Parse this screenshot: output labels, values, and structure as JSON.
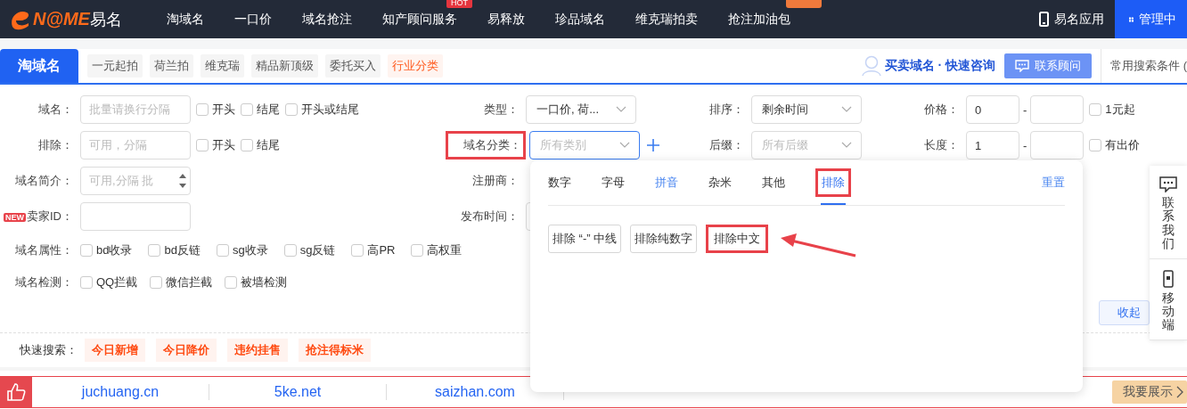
{
  "nav": {
    "logo": {
      "mark": "N@ME",
      "cn": "易名"
    },
    "items": [
      {
        "label": "淘域名"
      },
      {
        "label": "一口价"
      },
      {
        "label": "域名抢注"
      },
      {
        "label": "知产顾问服务",
        "badge": "HOT"
      },
      {
        "label": "易释放"
      },
      {
        "label": "珍品域名"
      },
      {
        "label": "维克瑞拍卖"
      },
      {
        "label": "抢注加油包",
        "flag": true
      }
    ],
    "app": "易名应用",
    "admin": "管理中"
  },
  "tabbar": {
    "main": "淘域名",
    "tabs": [
      {
        "label": "一元起拍",
        "selected": false
      },
      {
        "label": "荷兰拍",
        "selected": false
      },
      {
        "label": "维克瑞",
        "selected": false
      },
      {
        "label": "精品新顶级",
        "selected": false
      },
      {
        "label": "委托买入",
        "selected": false
      },
      {
        "label": "行业分类",
        "selected": true
      }
    ],
    "consult": "买卖域名 · 快速咨询",
    "contact": "联系顾问",
    "saved": "常用搜索条件 ("
  },
  "form": {
    "rows": [
      [
        {
          "label": "域名：",
          "kind": "input",
          "placeholder": "批量请换行分隔",
          "options": [
            {
              "label": "开头",
              "checked": false
            },
            {
              "label": "结尾",
              "checked": false
            },
            {
              "label": "开头或结尾",
              "checked": false
            }
          ]
        },
        {
          "label": "类型：",
          "kind": "select",
          "value": "一口价, 荷..."
        },
        {
          "label": "排序：",
          "kind": "select",
          "value": "剩余时间"
        },
        {
          "label": "价格：",
          "kind": "range",
          "from": "0",
          "separator": "-",
          "option": {
            "label": "1元起",
            "checked": false
          }
        }
      ],
      [
        {
          "label": "排除：",
          "kind": "input",
          "placeholder": "可用，分隔",
          "options": [
            {
              "label": "开头",
              "checked": false
            },
            {
              "label": "结尾",
              "checked": false
            }
          ]
        },
        {
          "label": "域名分类：",
          "kind": "select",
          "placeholder": "所有类别",
          "annotated": true,
          "focused": true,
          "plus": true
        },
        {
          "label": "后缀：",
          "kind": "select",
          "placeholder": "所有后缀"
        },
        {
          "label": "长度：",
          "kind": "range",
          "from": "1",
          "separator": "-",
          "option": {
            "label": "有出价",
            "checked": false
          }
        }
      ],
      [
        {
          "label": "域名简介：",
          "kind": "input",
          "placeholder": "可用,分隔 批",
          "spinner": true
        },
        {
          "label": "注册商：",
          "kind": "label"
        }
      ],
      [
        {
          "label": "卖家ID：",
          "kind": "input",
          "badge": "NEW"
        },
        {
          "label": "发布时间：",
          "kind": "input"
        }
      ]
    ],
    "attributes": {
      "label": "域名属性：",
      "options": [
        {
          "label": "bd收录",
          "checked": false
        },
        {
          "label": "bd反链",
          "checked": false
        },
        {
          "label": "sg收录",
          "checked": false
        },
        {
          "label": "sg反链",
          "checked": false
        },
        {
          "label": "高PR",
          "checked": false
        },
        {
          "label": "高权重",
          "checked": false
        }
      ]
    },
    "checks": {
      "label": "域名检测：",
      "options": [
        {
          "label": "QQ拦截",
          "checked": false
        },
        {
          "label": "微信拦截",
          "checked": false
        },
        {
          "label": "被墙检测",
          "checked": false
        }
      ]
    },
    "collapse": "收起"
  },
  "quick": {
    "label": "快速搜索：",
    "tags": [
      "今日新增",
      "今日降价",
      "违约挂售",
      "抢注得标米"
    ]
  },
  "links": {
    "items": [
      "juchuang.cn",
      "5ke.net",
      "saizhan.com"
    ],
    "show": "我要展示"
  },
  "side": [
    {
      "label": "联系我们",
      "kind": "chat"
    },
    {
      "label": "移动端",
      "kind": "mobile"
    }
  ],
  "panel": {
    "tabs": [
      {
        "label": "数字",
        "selected": false,
        "active": false
      },
      {
        "label": "字母",
        "selected": false,
        "active": false
      },
      {
        "label": "拼音",
        "selected": false,
        "active": true
      },
      {
        "label": "杂米",
        "selected": false,
        "active": false
      },
      {
        "label": "其他",
        "selected": false,
        "active": false
      },
      {
        "label": "排除",
        "selected": true,
        "active": false,
        "annotated": true
      }
    ],
    "reset": "重置",
    "options": [
      {
        "label": "排除 “-” 中线",
        "annotated": false
      },
      {
        "label": "排除纯数字",
        "annotated": false
      },
      {
        "label": "排除中文",
        "annotated": true,
        "arrow": true
      }
    ]
  }
}
